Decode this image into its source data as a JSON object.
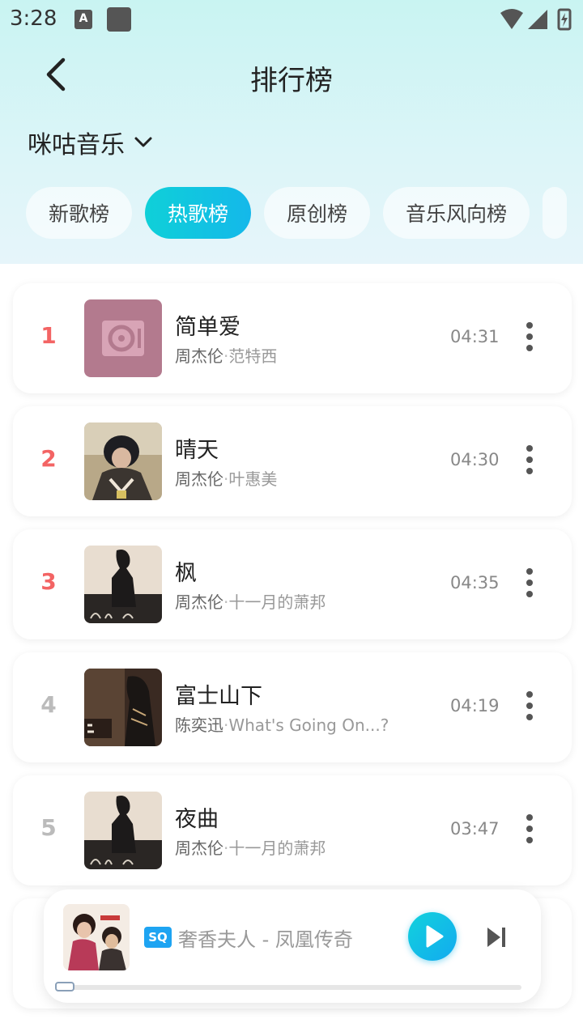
{
  "status_bar": {
    "time": "3:28",
    "notification_icon_text": "A"
  },
  "header": {
    "title": "排行榜",
    "back_icon": "chevron-left-icon"
  },
  "source": {
    "selected": "咪咕音乐",
    "icon": "chevron-down-icon"
  },
  "tabs": [
    {
      "label": "新歌榜",
      "active": false
    },
    {
      "label": "热歌榜",
      "active": true
    },
    {
      "label": "原创榜",
      "active": false
    },
    {
      "label": "音乐风向榜",
      "active": false
    }
  ],
  "songs": [
    {
      "rank": "1",
      "title": "简单爱",
      "artist": "周杰伦",
      "album": "范特西",
      "duration": "04:31"
    },
    {
      "rank": "2",
      "title": "晴天",
      "artist": "周杰伦",
      "album": "叶惠美",
      "duration": "04:30"
    },
    {
      "rank": "3",
      "title": "枫",
      "artist": "周杰伦",
      "album": "十一月的萧邦",
      "duration": "04:35"
    },
    {
      "rank": "4",
      "title": "富士山下",
      "artist": "陈奕迅",
      "album": "What's Going On...?",
      "duration": "04:19"
    },
    {
      "rank": "5",
      "title": "夜曲",
      "artist": "周杰伦",
      "album": "十一月的萧邦",
      "duration": "03:47"
    }
  ],
  "separator": "·",
  "player": {
    "quality_badge": "SQ",
    "now_playing": "奢香夫人 - 凤凰传奇",
    "progress": 0.0
  },
  "colors": {
    "accent": "#14b8ea",
    "top_rank": "#f36464",
    "header_bg": "#c9f4f2"
  }
}
